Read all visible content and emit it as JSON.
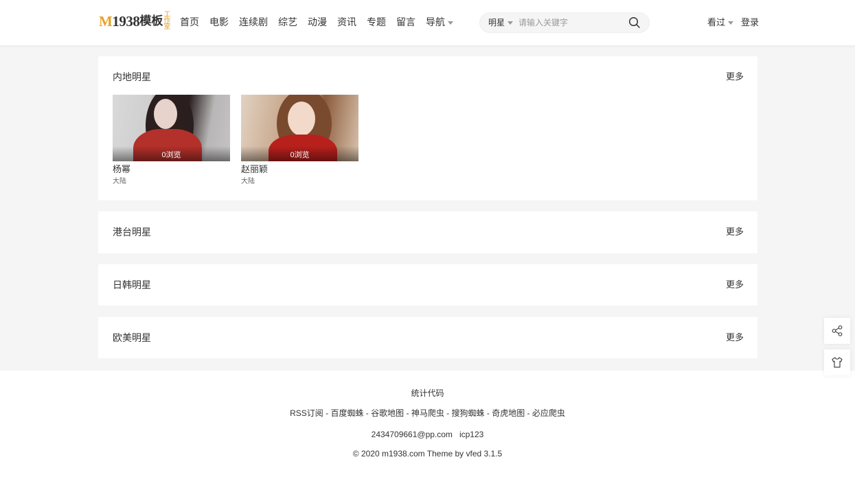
{
  "header": {
    "logo": {
      "m": "M",
      "num": "1938",
      "cn": "模板",
      "studio": [
        "工",
        "作",
        "室"
      ]
    },
    "nav": [
      {
        "label": "首页"
      },
      {
        "label": "电影"
      },
      {
        "label": "连续剧"
      },
      {
        "label": "综艺"
      },
      {
        "label": "动漫"
      },
      {
        "label": "资讯"
      },
      {
        "label": "专题"
      },
      {
        "label": "留言"
      },
      {
        "label": "导航"
      }
    ],
    "search": {
      "type": "明星",
      "placeholder": "请输入关键字"
    },
    "history": "看过",
    "login": "登录"
  },
  "sections": [
    {
      "title": "内地明星",
      "more": "更多",
      "cards": [
        {
          "name": "杨幂",
          "region": "大陆",
          "views": "0浏览"
        },
        {
          "name": "赵丽颖",
          "region": "大陆",
          "views": "0浏览"
        }
      ]
    },
    {
      "title": "港台明星",
      "more": "更多"
    },
    {
      "title": "日韩明星",
      "more": "更多"
    },
    {
      "title": "欧美明星",
      "more": "更多"
    }
  ],
  "footer": {
    "stats": "统计代码",
    "links": [
      "RSS订阅",
      "百度蜘蛛",
      "谷歌地图",
      "神马爬虫",
      "搜狗蜘蛛",
      "奇虎地图",
      "必应爬虫"
    ],
    "separator": " - ",
    "email": "2434709661@pp.com",
    "icp": "icp123",
    "copyright": "© 2020 m1938.com Theme by vfed 3.1.5"
  },
  "float": {
    "share_icon": "share-icon",
    "theme_icon": "tshirt-icon"
  },
  "colors": {
    "accent": "#e8a024",
    "bg": "#f5f5f5"
  }
}
